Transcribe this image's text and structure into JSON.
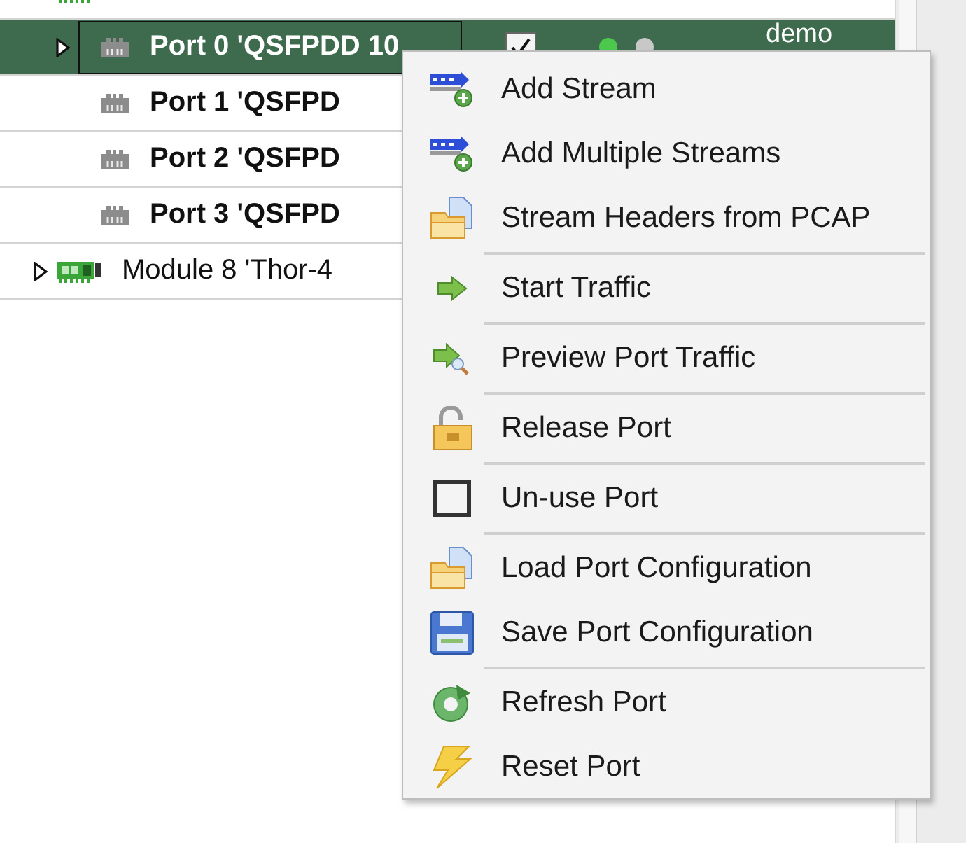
{
  "tree": [
    {
      "kind": "module",
      "expanded": true,
      "children": [
        {
          "kind": "port",
          "label": "Port 0 'QSFPDD 10",
          "selected": true,
          "expanded": false,
          "used": true,
          "leds": [
            {
              "color": "#4cc94c"
            },
            {
              "color": "#c8c8c8"
            }
          ],
          "owner": "demo"
        },
        {
          "kind": "port",
          "label": "Port 1 'QSFPD",
          "selected": false
        },
        {
          "kind": "port",
          "label": "Port 2 'QSFPD",
          "selected": false
        },
        {
          "kind": "port",
          "label": "Port 3 'QSFPD",
          "selected": false
        }
      ]
    },
    {
      "kind": "module",
      "label": "Module 8 'Thor-4",
      "expanded": false
    }
  ],
  "context_menu": {
    "groups": [
      [
        {
          "kind": "addstream",
          "label": "Add Stream"
        },
        {
          "kind": "addstream",
          "label": "Add Multiple Streams"
        },
        {
          "kind": "open",
          "label": "Stream Headers from PCAP"
        }
      ],
      [
        {
          "kind": "start",
          "label": "Start Traffic"
        }
      ],
      [
        {
          "kind": "preview",
          "label": "Preview Port Traffic"
        }
      ],
      [
        {
          "kind": "release",
          "label": "Release Port"
        }
      ],
      [
        {
          "kind": "unuse",
          "label": "Un-use Port"
        }
      ],
      [
        {
          "kind": "open",
          "label": "Load Port Configuration"
        },
        {
          "kind": "save",
          "label": "Save Port Configuration"
        }
      ],
      [
        {
          "kind": "refresh",
          "label": "Refresh Port"
        },
        {
          "kind": "reset",
          "label": "Reset Port"
        }
      ]
    ]
  }
}
